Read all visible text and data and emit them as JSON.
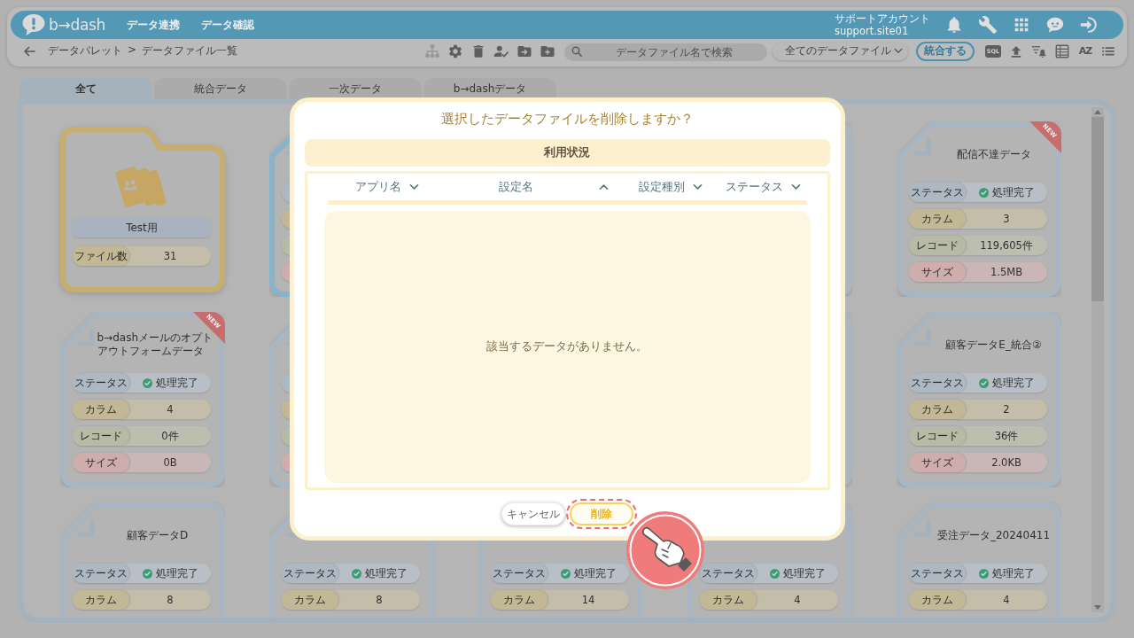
{
  "header": {
    "logo": "b→dash",
    "nav": [
      "データ連携",
      "データ確認"
    ],
    "account": {
      "name": "サポートアカウント",
      "id": "support.site01"
    }
  },
  "toolbar": {
    "breadcrumb": [
      {
        "label": "データパレット"
      },
      {
        "label": "データファイル一覧"
      }
    ],
    "separator": ">",
    "actions": [
      {
        "disabled": true
      },
      {
        "disabled": false
      },
      {
        "disabled": false
      },
      {
        "disabled": false
      },
      {
        "disabled": false
      },
      {
        "disabled": false
      }
    ],
    "search": {
      "placeholder": "データファイル名で検索"
    },
    "filter": {
      "value": "全てのデータファイル"
    },
    "merge_button": "統合する",
    "sql_label": "SQL",
    "sort_label": "AZ"
  },
  "tabs": [
    {
      "label": "全て",
      "selected": true
    },
    {
      "label": "統合データ",
      "selected": false
    },
    {
      "label": "一次データ",
      "selected": false
    },
    {
      "label": "b→dashデータ",
      "selected": false
    }
  ],
  "cards": [
    {
      "kind": "folder",
      "selected": false,
      "name": "Test用",
      "stats": [
        {
          "kind": "count",
          "label": "ファイル数",
          "value": "31"
        }
      ]
    },
    {
      "kind": "file",
      "selected": true,
      "stats": [
        {
          "kind": "status"
        },
        {
          "kind": "column"
        },
        {
          "kind": "record"
        },
        {
          "kind": "size"
        }
      ]
    },
    {
      "kind": "hidden"
    },
    {
      "kind": "file",
      "selected": false
    },
    {
      "kind": "file",
      "selected": false,
      "badge": "NEW",
      "title": "配信不達データ",
      "stats": [
        {
          "kind": "status",
          "label": "ステータス",
          "value": "処理完了"
        },
        {
          "kind": "column",
          "label": "カラム",
          "value": "3"
        },
        {
          "kind": "record",
          "label": "レコード",
          "value": "119,605件"
        },
        {
          "kind": "size",
          "label": "サイズ",
          "value": "1.5MB"
        }
      ]
    },
    {
      "kind": "file",
      "selected": false,
      "badge": "NEW",
      "title": "b→dashメールのオプトアウトフォームデータ",
      "stats": [
        {
          "kind": "status",
          "label": "ステータス",
          "value": "処理完了"
        },
        {
          "kind": "column",
          "label": "カラム",
          "value": "4"
        },
        {
          "kind": "record",
          "label": "レコード",
          "value": "0件"
        },
        {
          "kind": "size",
          "label": "サイズ",
          "value": "0B"
        }
      ]
    },
    {
      "kind": "file",
      "selected": false,
      "stats": [
        {
          "kind": "status"
        },
        {
          "kind": "column"
        },
        {
          "kind": "record"
        },
        {
          "kind": "size"
        }
      ]
    },
    {
      "kind": "hidden"
    },
    {
      "kind": "file",
      "selected": false
    },
    {
      "kind": "file",
      "selected": false,
      "title": "顧客データE_統合②",
      "stats": [
        {
          "kind": "status",
          "label": "ステータス",
          "value": "処理完了"
        },
        {
          "kind": "column",
          "label": "カラム",
          "value": "2"
        },
        {
          "kind": "record",
          "label": "レコード",
          "value": "36件"
        },
        {
          "kind": "size",
          "label": "サイズ",
          "value": "2.0KB"
        }
      ]
    },
    {
      "kind": "file",
      "selected": false,
      "title": "顧客データD",
      "stats": [
        {
          "kind": "status",
          "label": "ステータス",
          "value": "処理完了"
        },
        {
          "kind": "column",
          "label": "カラム",
          "value": "8"
        }
      ]
    },
    {
      "kind": "file",
      "selected": false,
      "stats": [
        {
          "kind": "status",
          "label": "ステータス",
          "value": "処理完了"
        },
        {
          "kind": "column",
          "label": "カラム",
          "value": "8"
        }
      ]
    },
    {
      "kind": "file",
      "selected": false,
      "stats": [
        {
          "kind": "status",
          "label": "ステータス",
          "value": "処理完了"
        },
        {
          "kind": "column",
          "label": "カラム",
          "value": "14"
        }
      ]
    },
    {
      "kind": "file",
      "selected": false,
      "stats": [
        {
          "kind": "status",
          "label": "ステータス",
          "value": "処理完了"
        },
        {
          "kind": "column",
          "label": "カラム",
          "value": "4"
        }
      ]
    },
    {
      "kind": "file",
      "selected": false,
      "title": "受注データ_20240411",
      "stats": [
        {
          "kind": "status",
          "label": "ステータス",
          "value": "処理完了"
        },
        {
          "kind": "column",
          "label": "カラム",
          "value": "4"
        }
      ]
    }
  ],
  "dialog": {
    "title": "選択したデータファイルを削除しますか？",
    "section": "利用状況",
    "columns": [
      {
        "label": "アプリ名",
        "ascending": false
      },
      {
        "label": "設定名",
        "ascending": true
      },
      {
        "label": "設定種別",
        "ascending": false
      },
      {
        "label": "ステータス",
        "ascending": false
      }
    ],
    "empty_message": "該当するデータがありません。",
    "buttons": [
      {
        "label": "キャンセル",
        "kind": "cancel",
        "highlighted": false
      },
      {
        "label": "削除",
        "kind": "delete",
        "highlighted": true
      }
    ]
  }
}
